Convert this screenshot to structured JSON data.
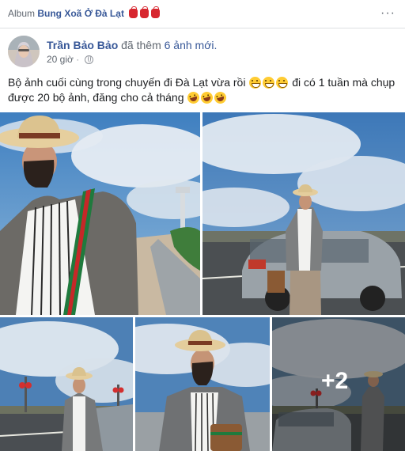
{
  "album": {
    "prefix": "Album",
    "title": "Bung Xoã Ở Đà Lạt",
    "title_icons": [
      "red-bag-icon",
      "red-bag-icon",
      "red-bag-icon"
    ]
  },
  "more_icon": "···",
  "post": {
    "author": "Trần Bảo Bảo",
    "action_prefix": "đã thêm",
    "action_strong": "6 ảnh mới.",
    "time": "20 giờ",
    "privacy_icon": "globe-icon",
    "text_part1": "Bộ ảnh cuối cùng trong chuyến đi Đà Lạt vừa rồi",
    "text_part2": "đi có 1 tuần mà chụp được 20 bộ ảnh, đăng cho cả tháng",
    "emoji_grin_count": 3,
    "emoji_laugh_count": 3
  },
  "photos": {
    "more_count_label": "+2"
  },
  "colors": {
    "link": "#385898",
    "secondary_text": "#606770",
    "emoji": "#ffcc33",
    "bag": "#d7262e"
  }
}
